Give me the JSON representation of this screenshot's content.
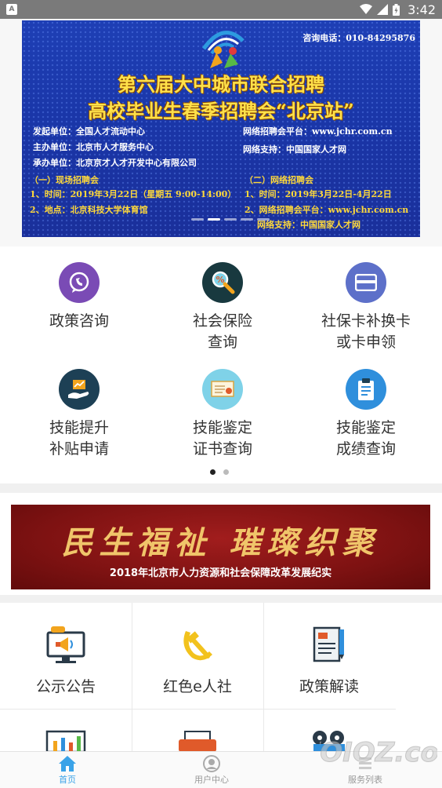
{
  "status_bar": {
    "time": "3:42",
    "app_badge": "A"
  },
  "banner": {
    "hotline": "咨询电话：010-84295876",
    "title_line1": "第六届大中城市联合招聘",
    "title_line2": "高校毕业生春季招聘会“北京站”",
    "left_info": [
      "发起单位：全国人才流动中心",
      "主办单位：北京市人才服务中心",
      "承办单位：北京京才人才开发中心有限公司"
    ],
    "right_info": [
      "网络招聘会平台：www.jchr.com.cn",
      "网络支持：中国国家人才网"
    ],
    "onsite_heading": "（一）现场招聘会",
    "onsite_time": "1、时间：2019年3月22日（星期五 9:00-14:00）",
    "onsite_place": "2、地点：北京科技大学体育馆",
    "online_heading": "（二）网络招聘会",
    "online_time": "1、时间：2019年3月22日-4月22日",
    "online_platform": "2、网络招聘会平台：www.jchr.com.cn",
    "online_support": "网络支持：中国国家人才网",
    "slide_count": 5,
    "active_slide": 1
  },
  "services": [
    {
      "label": "政策咨询",
      "icon": "chat-bubble-icon",
      "color": "#7a4bb5"
    },
    {
      "label": "社会保险\n查询",
      "icon": "magnifier-icon",
      "color": "#18393f"
    },
    {
      "label": "社保卡补换卡\n或卡申领",
      "icon": "card-icon",
      "color": "#5d70c9"
    },
    {
      "label": "技能提升\n补贴申请",
      "icon": "hand-chart-icon",
      "color": "#1d4055"
    },
    {
      "label": "技能鉴定\n证书查询",
      "icon": "certificate-icon",
      "color": "#7fd2e8"
    },
    {
      "label": "技能鉴定\n成绩查询",
      "icon": "clipboard-icon",
      "color": "#2f8fdc"
    }
  ],
  "services_pager": {
    "pages": 2,
    "active": 1
  },
  "ad_banner": {
    "headline": "民生福祉 璀璨织聚",
    "subtitle": "2018年北京市人力资源和社会保障改革发展纪实"
  },
  "grid": [
    {
      "label": "公示公告",
      "icon": "megaphone-screen-icon"
    },
    {
      "label": "红色e人社",
      "icon": "hammer-sickle-icon"
    },
    {
      "label": "政策解读",
      "icon": "document-pen-icon"
    }
  ],
  "tabs": [
    {
      "label": "首页",
      "icon": "home-icon",
      "active": true
    },
    {
      "label": "用户中心",
      "icon": "user-center-icon",
      "active": false
    },
    {
      "label": "服务列表",
      "icon": "list-icon",
      "active": false
    }
  ],
  "watermark": "WOIOZ.com"
}
